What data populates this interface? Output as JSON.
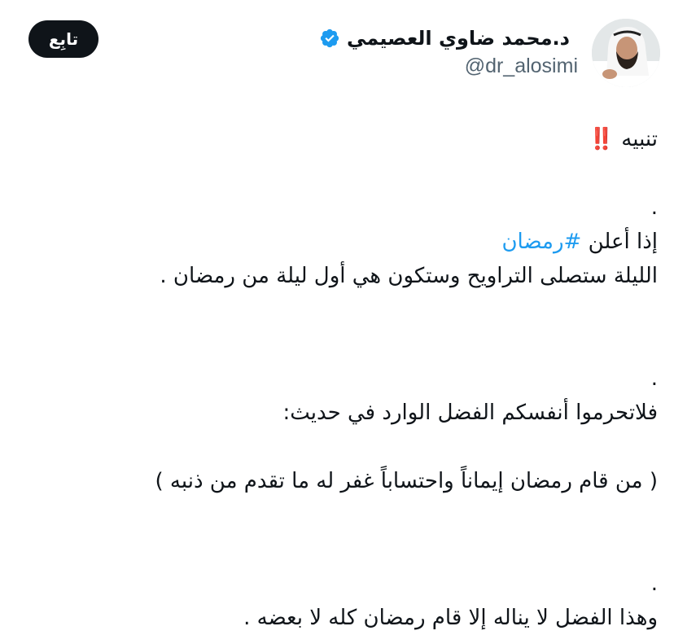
{
  "author": {
    "name": "د.محمد ضاوي العصيمي",
    "handle": "@dr_alosimi",
    "verified": true,
    "avatar_icon": "user-avatar-photo"
  },
  "follow_button": {
    "label": "تابِع"
  },
  "tweet": {
    "alert_word": "تنبيه",
    "alert_emoji": "‼️",
    "dot": ".",
    "hashtag_prefix": "إذا أعلن",
    "hashtag": "#رمضان",
    "line_1": "الليلة ستصلى التراويح وستكون هي أول ليلة من رمضان .",
    "line_2": "فلاتحرموا أنفسكم الفضل الوارد في حديث:",
    "line_3": "( من قام رمضان إيماناً واحتساباً غفر له ما تقدم من ذنبه )",
    "line_4": "وهذا الفضل لا يناله إلا قام رمضان كله لا بعضه ."
  },
  "colors": {
    "text": "#0f1419",
    "secondary": "#536471",
    "link": "#1d9bf0",
    "verified_badge": "#1d9bf0",
    "button_bg": "#0f1419",
    "alert": "#e0245e"
  }
}
